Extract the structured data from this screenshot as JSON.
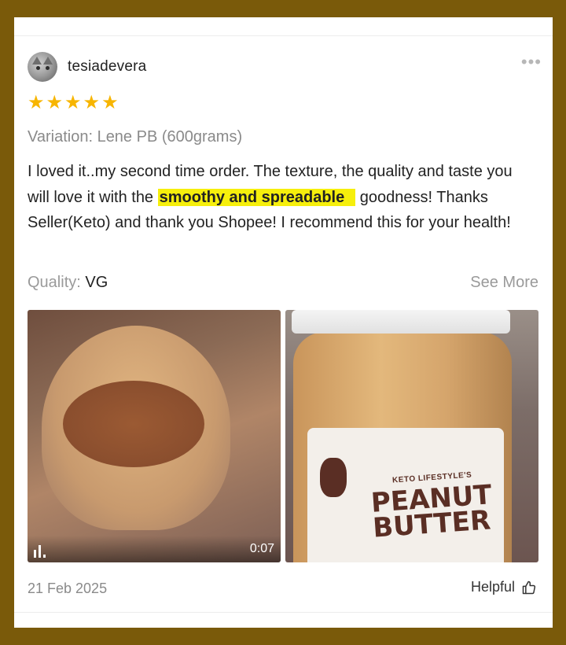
{
  "review": {
    "username": "tesiadevera",
    "rating": 5,
    "stars": [
      "★",
      "★",
      "★",
      "★",
      "★"
    ],
    "variation": "Variation: Lene PB (600grams)",
    "text_before": "I loved it..my second time order. The texture, the quality and taste you will love it with the ",
    "text_highlight": "smoothy and spreadable",
    "text_after": " goodness! Thanks Seller(Keto) and thank you Shopee! I recommend this for your health!",
    "quality_label": "Quality:",
    "quality_value": " VG",
    "see_more": "See More",
    "video_duration": "0:07",
    "label_small": "KETO LIFESTYLE'S",
    "label_big": "PEANUT BUTTER",
    "date": "21 Feb 2025",
    "helpful": "Helpful"
  },
  "colors": {
    "border": "#7a5a0a",
    "star": "#f7b500",
    "highlight": "#f6ef0c"
  },
  "icons": {
    "more": "more-dots-icon",
    "volume": "volume-bars-icon",
    "thumb": "thumbs-up-icon"
  }
}
